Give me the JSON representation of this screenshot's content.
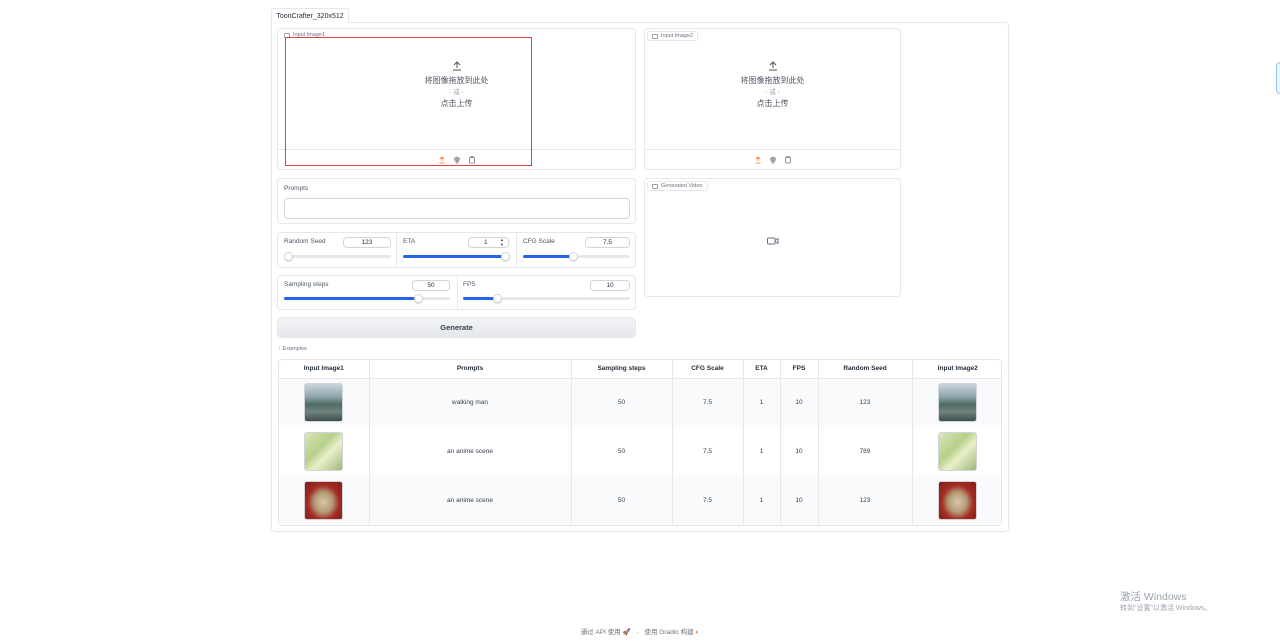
{
  "tab": {
    "label": "ToonCrafter_320x512"
  },
  "input_image1": {
    "label": "Input Image1",
    "drop_text": "将图像拖放到此处",
    "or_text": "- 或 -",
    "click_text": "点击上传",
    "highlight_color": "#e53e3e"
  },
  "input_image2": {
    "label": "Input Image2",
    "drop_text": "将图像拖放到此处",
    "or_text": "- 或 -",
    "click_text": "点击上传"
  },
  "prompts": {
    "label": "Prompts",
    "value": ""
  },
  "random_seed": {
    "label": "Random Seed",
    "value": "123",
    "level": 0.0
  },
  "eta": {
    "label": "ETA",
    "value": "1",
    "level": 1.0
  },
  "cfg_scale": {
    "label": "CFG Scale",
    "value": "7.5",
    "level": 0.47
  },
  "sampling_steps": {
    "label": "Sampling steps",
    "value": "50",
    "level": 0.8
  },
  "fps": {
    "label": "FPS",
    "value": "10",
    "level": 0.2
  },
  "generated_video": {
    "label": "Generated Video"
  },
  "generate_button": {
    "label": "Generate"
  },
  "examples": {
    "label": "Examples",
    "headers": [
      "Input Image1",
      "Prompts",
      "Sampling steps",
      "CFG Scale",
      "ETA",
      "FPS",
      "Random Seed",
      "Input Image2"
    ],
    "rows": [
      {
        "prompt": "walking man",
        "steps": "50",
        "cfg": "7.5",
        "eta": "1",
        "fps": "10",
        "seed": "123"
      },
      {
        "prompt": "an anime scene",
        "steps": "50",
        "cfg": "7.5",
        "eta": "1",
        "fps": "10",
        "seed": "789"
      },
      {
        "prompt": "an anime scene",
        "steps": "50",
        "cfg": "7.5",
        "eta": "1",
        "fps": "10",
        "seed": "123"
      }
    ]
  },
  "footer": {
    "api_text": "通过 API 使用",
    "sep": "·",
    "built_text": "使用 Gradio 构建"
  },
  "watermark": {
    "line1": "激活 Windows",
    "line2": "转到\"设置\"以激活 Windows。"
  },
  "colors": {
    "accent": "#2563eb",
    "upload_icon": "#f97316"
  }
}
